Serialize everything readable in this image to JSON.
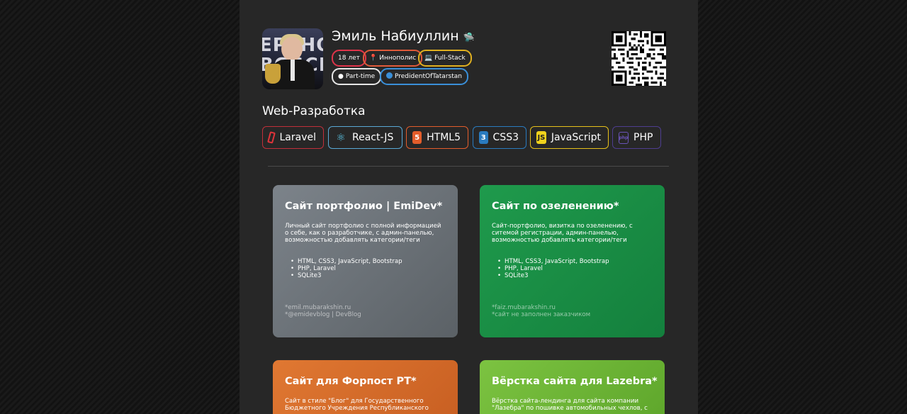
{
  "profile": {
    "name": "Эмиль Набиуллин",
    "avatar_text": "EPTHO\nBOSCI"
  },
  "tags": [
    {
      "label": "18 лет",
      "icon": "",
      "color": "#e0344a"
    },
    {
      "label": "Иннополис",
      "icon": "location-icon",
      "color": "#e05a3a"
    },
    {
      "label": "Full-Stack",
      "icon": "laptop-icon",
      "color": "#e0b020"
    },
    {
      "label": "Part-time",
      "icon": "clock-icon",
      "color": "#e6e6e6"
    },
    {
      "label": "PredidentOfTatarstan",
      "icon": "telegram-icon",
      "color": "#3a8fd8"
    }
  ],
  "section": {
    "title": "Web-Разработка"
  },
  "skills": [
    {
      "label": "Laravel",
      "icon": "laravel-icon",
      "color": "#c0303a"
    },
    {
      "label": "React-JS",
      "icon": "react-icon",
      "color": "#5aa9d6"
    },
    {
      "label": "HTML5",
      "icon": "html5-icon",
      "color": "#e35d2b"
    },
    {
      "label": "CSS3",
      "icon": "css3-icon",
      "color": "#2a7bbf"
    },
    {
      "label": "JavaScript",
      "icon": "javascript-icon",
      "color": "#e6c01a"
    },
    {
      "label": "PHP",
      "icon": "php-icon",
      "color": "#4e3d8f"
    }
  ],
  "cards": [
    {
      "title": "Сайт портфолио | EmiDev*",
      "desc": "Личный сайт портфолио с полной информацией о себе, как о разработчике, с админ-панелью, возможностью добавлять категории/теги",
      "stack": [
        "HTML, CSS3, JavaScript, Bootstrap",
        "PHP, Laravel",
        "SQLite3"
      ],
      "foot": [
        "*emil.mubarakshin.ru",
        "*@emidevblog | DevBlog"
      ],
      "color1": "#7c838a",
      "color2": "#5b6166"
    },
    {
      "title": "Сайт по озеленению*",
      "desc": "Сайт-портфолио, визитка по озеленению, с ситемой регистрации, админ-панелью, возможностью добавлять категории/теги",
      "stack": [
        "HTML, CSS3, JavaScript, Bootstrap",
        "PHP, Laravel",
        "SQLite3"
      ],
      "foot": [
        "*faiz.mubarakshin.ru",
        "*сайт не заполнен заказчиком"
      ],
      "color1": "#1f9a4c",
      "color2": "#14803d"
    },
    {
      "title": "Сайт для Форпост РТ*",
      "desc": "Сайт в стиле \"Блог\" для Государственного Бюджетного Учреждения Республиканского",
      "stack": [],
      "foot": [],
      "color1": "#e07832",
      "color2": "#c85f22"
    },
    {
      "title": "Вёрстка сайта для Lazebra*",
      "desc": "Вёрстка сайта-лендинга для сайта компании \"Лазебра\" по пошивке автомобильных чехлов, с",
      "stack": [],
      "foot": [],
      "color1": "#7cc341",
      "color2": "#5ea62b"
    }
  ]
}
